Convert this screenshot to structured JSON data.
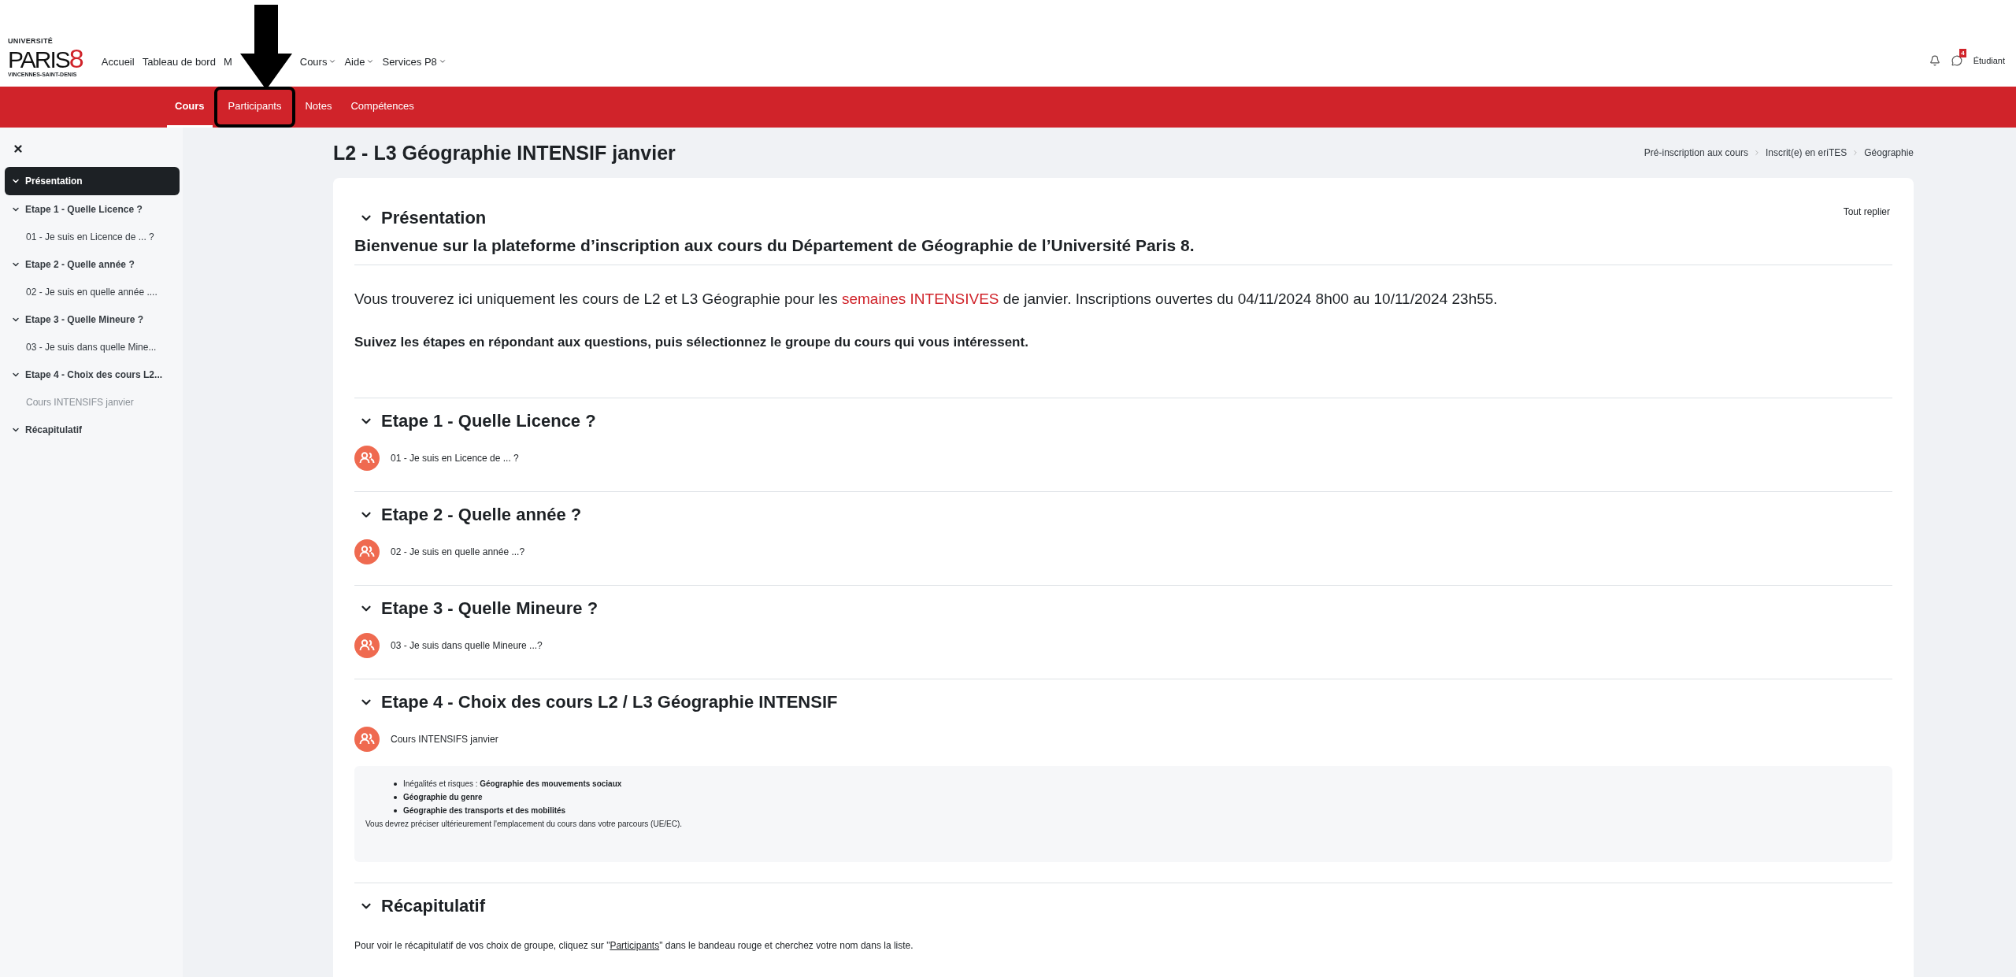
{
  "header": {
    "logo": {
      "top": "UNIVERSITÉ",
      "main": "PARIS",
      "digit": "8",
      "bottom": "VINCENNES-SAINT-DENIS"
    },
    "nav": [
      {
        "label": "Accueil",
        "dropdown": false
      },
      {
        "label": "Tableau de bord",
        "dropdown": false
      },
      {
        "label": "M",
        "dropdown": false
      },
      {
        "label": "Cours",
        "dropdown": true
      },
      {
        "label": "Aide",
        "dropdown": true
      },
      {
        "label": "Services P8",
        "dropdown": true
      }
    ],
    "messages_badge": "4",
    "user": "Étudiant"
  },
  "course_nav": [
    {
      "label": "Cours",
      "selected": true,
      "highlighted": false
    },
    {
      "label": "Participants",
      "selected": false,
      "highlighted": true
    },
    {
      "label": "Notes",
      "selected": false,
      "highlighted": false
    },
    {
      "label": "Compétences",
      "selected": false,
      "highlighted": false
    }
  ],
  "sidebar": {
    "items": [
      {
        "label": "Présentation",
        "selected": true,
        "expanded": true
      },
      {
        "label": "Etape 1 - Quelle Licence ?",
        "selected": false,
        "expanded": true,
        "children": [
          {
            "label": "01 - Je suis en Licence de ... ?",
            "dimmed": false
          }
        ]
      },
      {
        "label": "Etape 2 - Quelle année ?",
        "selected": false,
        "expanded": true,
        "children": [
          {
            "label": "02 - Je suis en quelle année ....",
            "dimmed": false
          }
        ]
      },
      {
        "label": "Etape 3 - Quelle Mineure ?",
        "selected": false,
        "expanded": true,
        "children": [
          {
            "label": "03 - Je suis dans quelle Mine...",
            "dimmed": false
          }
        ]
      },
      {
        "label": "Etape 4 - Choix des cours L2...",
        "selected": false,
        "expanded": true,
        "children": [
          {
            "label": "Cours INTENSIFS janvier",
            "dimmed": true
          }
        ]
      },
      {
        "label": "Récapitulatif",
        "selected": false,
        "expanded": true
      }
    ]
  },
  "page": {
    "title": "L2 - L3 Géographie INTENSIF janvier",
    "breadcrumb": [
      "Pré-inscription aux cours",
      "Inscrit(e) en eriTES",
      "Géographie"
    ],
    "collapse_all": "Tout replier",
    "sections": [
      {
        "title": "Présentation",
        "expanded": true,
        "heading": "Bienvenue sur la plateforme d’inscription aux cours du Département de Géographie de l’Université Paris 8.",
        "paragraphs": [
          {
            "kind": "plain",
            "segments": [
              {
                "text": "Vous trouverez ici uniquement les cours de L2 et L3 Géographie pour les ",
                "kind": "plain"
              },
              {
                "text": "semaines INTENSIVES",
                "kind": "highlight"
              },
              {
                "text": " de janvier. Inscriptions ouvertes du 04/11/2024 8h00 au 10/11/2024 23h55.",
                "kind": "plain"
              }
            ]
          },
          {
            "kind": "bold",
            "segments": [
              {
                "text": "Suivez les étapes en répondant aux questions, puis sélectionnez le groupe du cours qui vous intéressent.",
                "kind": "plain"
              }
            ]
          }
        ]
      },
      {
        "title": "Etape 1 - Quelle Licence ?",
        "expanded": true,
        "activities": [
          {
            "label": "01 - Je suis en Licence de ... ?"
          }
        ]
      },
      {
        "title": "Etape 2 - Quelle année ?",
        "expanded": true,
        "activities": [
          {
            "label": "02 - Je suis en quelle année ...?"
          }
        ]
      },
      {
        "title": "Etape 3 - Quelle Mineure ?",
        "expanded": true,
        "activities": [
          {
            "label": "03 - Je suis dans quelle Mineure ...?"
          }
        ]
      },
      {
        "title": "Etape 4 - Choix des cours L2 / L3 Géographie INTENSIF",
        "expanded": true,
        "activities": [
          {
            "label": "Cours INTENSIFS janvier"
          }
        ],
        "description": {
          "items": [
            "Inégalités et risques : **Géographie des mouvements sociaux**",
            "**Géographie du genre**",
            "**Géographie des transports et des mobilités**"
          ],
          "note": "Vous devrez préciser ultérieurement l'emplacement du cours dans votre parcours (UE/EC)."
        }
      },
      {
        "title": "Récapitulatif",
        "expanded": true,
        "paragraphs": [
          {
            "kind": "small",
            "segments": [
              {
                "text": "Pour voir le récapitulatif de vos choix de groupe, cliquez sur \"",
                "kind": "plain"
              },
              {
                "text": "Participants",
                "kind": "link"
              },
              {
                "text": "\" dans le bandeau rouge et cherchez votre nom dans la liste.",
                "kind": "plain"
              }
            ]
          }
        ]
      }
    ]
  }
}
